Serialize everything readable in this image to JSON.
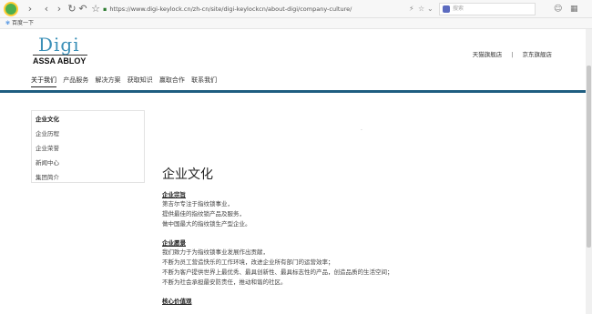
{
  "browser": {
    "url": "https://www.digi-keylock.cn/zh-cn/site/digi-keylockcn/about-digi/company-culture/",
    "search_placeholder": "搜索",
    "bookmark_label": "百度一下"
  },
  "header": {
    "logo_text": "Digi",
    "logo_subtext": "ASSA ABLOY",
    "store_links": [
      "天猫旗舰店",
      "京东旗舰店"
    ],
    "store_separator": "|"
  },
  "nav": {
    "items": [
      "关于我们",
      "产品服务",
      "解决方案",
      "获取知识",
      "赢取合作",
      "联系我们"
    ]
  },
  "sidebar": {
    "title": "企业文化",
    "items": [
      "企业历程",
      "企业荣誉",
      "新闻中心",
      "集团简介"
    ]
  },
  "content": {
    "page_title": "企业文化",
    "sections": [
      {
        "title": "企业宗旨",
        "lines": [
          "第吉尔专注于指纹锁事业，",
          "提供最佳的指纹锁产品及服务，",
          "做中国最大的指纹锁生产型企业。"
        ]
      },
      {
        "title": "企业愿景",
        "lines": [
          "我们致力于为指纹锁事业发展作出贡献，",
          "不断为员工营造快乐的工作环境，改进企业所有部门的运营效率；",
          "不断为客户提供世界上最优秀、最具创新性、最具标志性的产品，创造品质的生活空间；",
          "不断为社会承担最安防责任，推动和谐的社区。"
        ]
      },
      {
        "title": "核心价值观",
        "lines": []
      }
    ]
  },
  "colors": {
    "brand_blue": "#3a8fb7",
    "nav_bar": "#1e5d80"
  }
}
